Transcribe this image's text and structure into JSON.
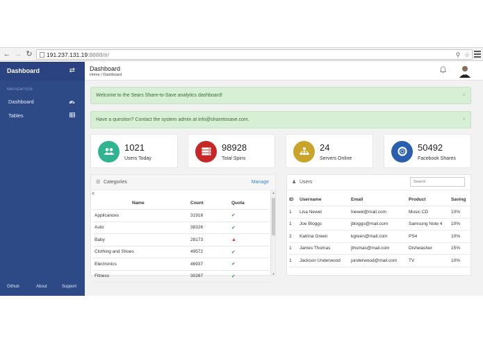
{
  "browser": {
    "url_host": "191.237.131.19",
    "url_rest": ":8888/#/"
  },
  "sidebar": {
    "title": "Dashboard",
    "section": "NAVIGATION",
    "items": [
      {
        "label": "Dashboard",
        "icon": "dashboard-icon"
      },
      {
        "label": "Tables",
        "icon": "table-icon"
      }
    ],
    "footer": [
      "Github",
      "About",
      "Support"
    ]
  },
  "header": {
    "title": "Dashboard",
    "breadcrumb": "Home / Dashboard"
  },
  "alerts": [
    "Welcome to the Sears Share-to-Save analytics dashboard!",
    "Have a question? Contact the system admin at info@sharetosave.com."
  ],
  "stats": [
    {
      "value": "1021",
      "label": "Users Today",
      "color": "#2fb391",
      "icon": "users-icon"
    },
    {
      "value": "98928",
      "label": "Total Spins",
      "color": "#c62828",
      "icon": "server-icon"
    },
    {
      "value": "24",
      "label": "Servers Online",
      "color": "#c9a32a",
      "icon": "sitemap-icon"
    },
    {
      "value": "50492",
      "label": "Facebook Shares",
      "color": "#2a5fb0",
      "icon": "life-ring-icon"
    }
  ],
  "categories": {
    "title": "Categories",
    "manage": "Manage",
    "columns": [
      "Name",
      "Count",
      "Quota"
    ],
    "rows": [
      {
        "name": "Applicances",
        "count": "31918",
        "quota": "ok"
      },
      {
        "name": "Auto",
        "count": "38326",
        "quota": "ok"
      },
      {
        "name": "Baby",
        "count": "28173",
        "quota": "warn"
      },
      {
        "name": "Clothing and Shoes",
        "count": "49572",
        "quota": "ok"
      },
      {
        "name": "Electronics",
        "count": "46937",
        "quota": "ok"
      },
      {
        "name": "Fitness",
        "count": "30287",
        "quota": "ok"
      }
    ]
  },
  "users": {
    "title": "Users",
    "search_placeholder": "Search",
    "columns": [
      "ID",
      "Username",
      "Email",
      "Product",
      "Saving"
    ],
    "rows": [
      {
        "id": "1",
        "username": "Lisa Newel",
        "email": "lnewel@mail.com",
        "product": "Music CD",
        "saving": "10%"
      },
      {
        "id": "1",
        "username": "Joe Bloggs",
        "email": "jbloggs@mail.com",
        "product": "Samsung Note 4",
        "saving": "10%"
      },
      {
        "id": "2",
        "username": "Katrina Green",
        "email": "kgreen@mail.com",
        "product": "PS4",
        "saving": "10%"
      },
      {
        "id": "1",
        "username": "James Thomas",
        "email": "jthomas@mail.com",
        "product": "Dishwasher",
        "saving": "15%"
      },
      {
        "id": "1",
        "username": "Jackson Underwood",
        "email": "junderwood@mail.com",
        "product": "TV",
        "saving": "10%"
      }
    ]
  }
}
